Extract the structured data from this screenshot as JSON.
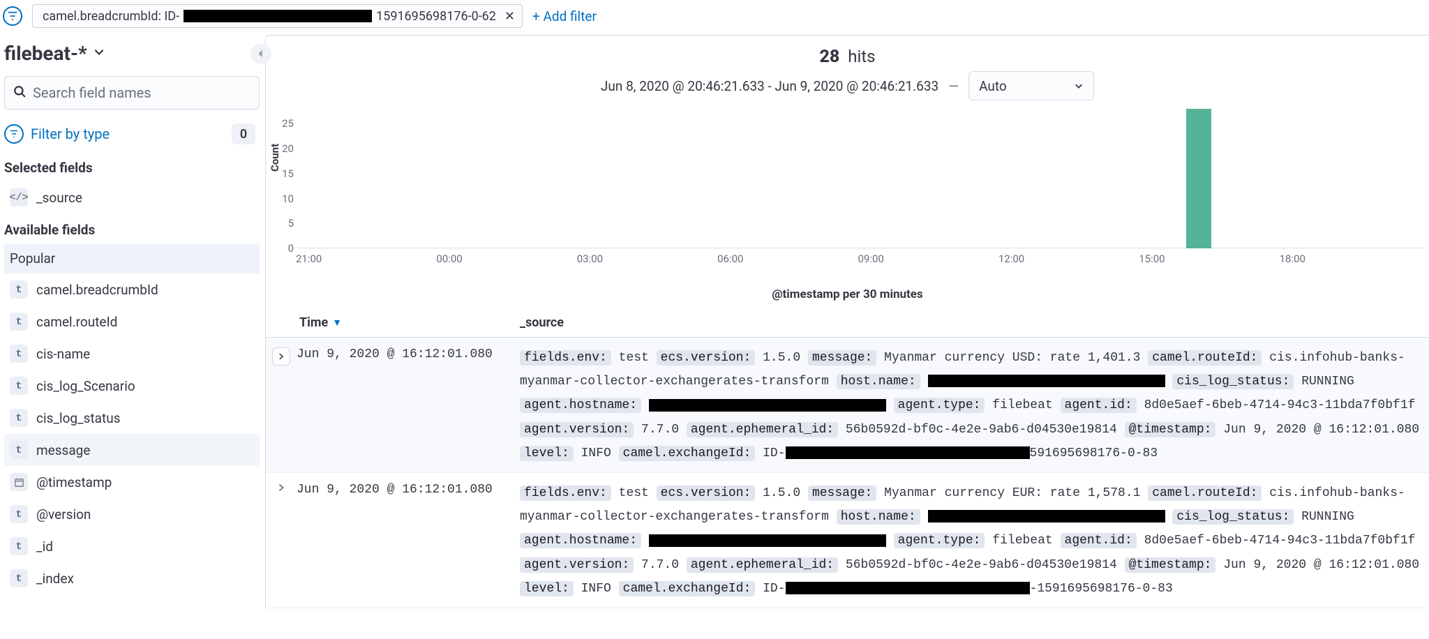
{
  "filterBar": {
    "pillPrefix": "camel.breadcrumbId: ID-",
    "pillSuffix": "1591695698176-0-62",
    "addFilter": "+ Add filter"
  },
  "sidebar": {
    "indexPattern": "filebeat-*",
    "searchPlaceholder": "Search field names",
    "filterByType": "Filter by type",
    "typeCount": "0",
    "selectedTitle": "Selected fields",
    "selected": [
      {
        "badge": "</>",
        "name": "_source"
      }
    ],
    "availableTitle": "Available fields",
    "popularLabel": "Popular",
    "popular": [
      {
        "badge": "t",
        "name": "camel.breadcrumbId"
      },
      {
        "badge": "t",
        "name": "camel.routeId"
      },
      {
        "badge": "t",
        "name": "cis-name"
      },
      {
        "badge": "t",
        "name": "cis_log_Scenario"
      },
      {
        "badge": "t",
        "name": "cis_log_status"
      },
      {
        "badge": "t",
        "name": "message"
      }
    ],
    "other": [
      {
        "badge": "cal",
        "name": "@timestamp"
      },
      {
        "badge": "t",
        "name": "@version"
      },
      {
        "badge": "t",
        "name": "_id"
      },
      {
        "badge": "t",
        "name": "_index"
      }
    ]
  },
  "main": {
    "hitsCount": "28",
    "hitsLabel": "hits",
    "range": "Jun 8, 2020 @ 20:46:21.633 - Jun 9, 2020 @ 20:46:21.633",
    "intervalSelected": "Auto",
    "xAxisLabel": "@timestamp per 30 minutes",
    "yAxisLabel": "Count"
  },
  "chart_data": {
    "type": "bar",
    "title": "",
    "xlabel": "@timestamp per 30 minutes",
    "ylabel": "Count",
    "ylim": [
      0,
      28
    ],
    "yticks": [
      0,
      5,
      10,
      15,
      20,
      25
    ],
    "xticks": [
      "21:00",
      "00:00",
      "03:00",
      "06:00",
      "09:00",
      "12:00",
      "15:00",
      "18:00"
    ],
    "categories": [
      "16:00"
    ],
    "values": [
      28
    ]
  },
  "table": {
    "headers": {
      "time": "Time",
      "source": "_source"
    },
    "rows": [
      {
        "expanded": true,
        "time": "Jun 9, 2020 @ 16:12:01.080",
        "fields": [
          {
            "k": "fields.env:",
            "v": "test"
          },
          {
            "k": "ecs.version:",
            "v": "1.5.0"
          },
          {
            "k": "message:",
            "v": "Myanmar currency USD: rate 1,401.3"
          },
          {
            "k": "camel.routeId:",
            "v": "cis.infohub-banks-myanmar-collector-exchangerates-transform"
          },
          {
            "k": "host.name:",
            "v": "[REDACT:340]"
          },
          {
            "k": "cis_log_status:",
            "v": "RUNNING"
          },
          {
            "k": "agent.hostname:",
            "v": "[REDACT:340]"
          },
          {
            "k": "agent.type:",
            "v": "filebeat"
          },
          {
            "k": "agent.id:",
            "v": "8d0e5aef-6beb-4714-94c3-11bda7f0bf1f"
          },
          {
            "k": "agent.version:",
            "v": "7.7.0"
          },
          {
            "k": "agent.ephemeral_id:",
            "v": "56b0592d-bf0c-4e2e-9ab6-d04530e19814"
          },
          {
            "k": "@timestamp:",
            "v": "Jun 9, 2020 @ 16:12:01.080"
          },
          {
            "k": "level:",
            "v": "INFO"
          },
          {
            "k": "camel.exchangeId:",
            "v": "ID-",
            "redact": 350,
            "suffix": "591695698176-0-83"
          }
        ]
      },
      {
        "expanded": false,
        "time": "Jun 9, 2020 @ 16:12:01.080",
        "fields": [
          {
            "k": "fields.env:",
            "v": "test"
          },
          {
            "k": "ecs.version:",
            "v": "1.5.0"
          },
          {
            "k": "message:",
            "v": "Myanmar currency EUR: rate 1,578.1"
          },
          {
            "k": "camel.routeId:",
            "v": "cis.infohub-banks-myanmar-collector-exchangerates-transform"
          },
          {
            "k": "host.name:",
            "v": "[REDACT:340]"
          },
          {
            "k": "cis_log_status:",
            "v": "RUNNING"
          },
          {
            "k": "agent.hostname:",
            "v": "[REDACT:340]"
          },
          {
            "k": "agent.type:",
            "v": "filebeat"
          },
          {
            "k": "agent.id:",
            "v": "8d0e5aef-6beb-4714-94c3-11bda7f0bf1f"
          },
          {
            "k": "agent.version:",
            "v": "7.7.0"
          },
          {
            "k": "agent.ephemeral_id:",
            "v": "56b0592d-bf0c-4e2e-9ab6-d04530e19814"
          },
          {
            "k": "@timestamp:",
            "v": "Jun 9, 2020 @ 16:12:01.080"
          },
          {
            "k": "level:",
            "v": "INFO"
          },
          {
            "k": "camel.exchangeId:",
            "v": "ID-",
            "redact": 350,
            "suffix": "-1591695698176-0-83"
          }
        ]
      }
    ]
  }
}
